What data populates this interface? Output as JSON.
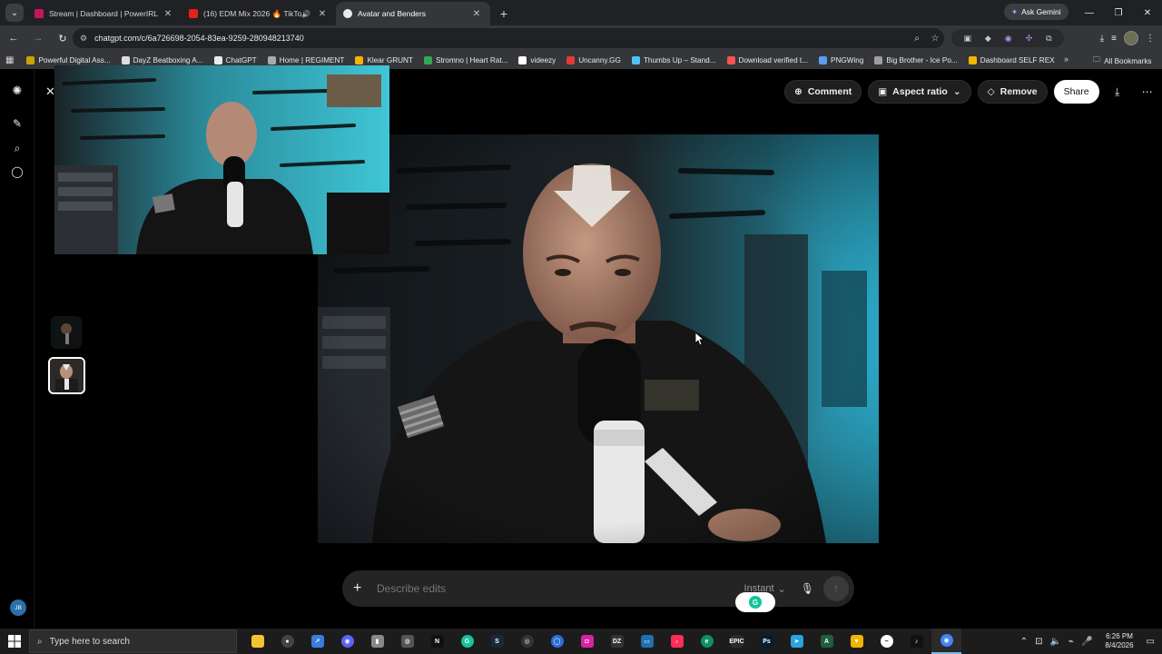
{
  "browser": {
    "tabs": [
      {
        "label": "Stream | Dashboard | PowerIRL",
        "fav_color": "#c2185b",
        "active": false
      },
      {
        "label": "(16) EDM Mix 2026 🔥 TikTo",
        "fav_color": "#e62117",
        "active": false,
        "audio": true
      },
      {
        "label": "Avatar and Benders",
        "fav_color": "#e8eaed",
        "active": true
      }
    ],
    "ask_gemini": "Ask Gemini",
    "url": "chatgpt.com/c/6a726698-2054-83ea-9259-280948213740",
    "bookmarks": [
      {
        "label": "Powerful Digital Ass...",
        "color": "#c7a400"
      },
      {
        "label": "DayZ Beatboxing A...",
        "color": "#dddddd"
      },
      {
        "label": "ChatGPT",
        "color": "#e8eaed"
      },
      {
        "label": "Home | REGIMENT",
        "color": "#aaaaaa"
      },
      {
        "label": "Klear GRUNT",
        "color": "#f4b400"
      },
      {
        "label": "Stromno | Heart Rat...",
        "color": "#34a853"
      },
      {
        "label": "videezy",
        "color": "#ffffff"
      },
      {
        "label": "Uncanny.GG",
        "color": "#e53935"
      },
      {
        "label": "Thumbs Up – Stand...",
        "color": "#4fc3f7"
      },
      {
        "label": "Download verified t...",
        "color": "#ff5252"
      },
      {
        "label": "PNGWing",
        "color": "#5c9cf5"
      },
      {
        "label": "Big Brother - Ice Po...",
        "color": "#9e9e9e"
      },
      {
        "label": "Dashboard SELF REX",
        "color": "#f5b400"
      }
    ],
    "all_bookmarks": "All Bookmarks"
  },
  "chat": {
    "actions": {
      "comment": "Comment",
      "aspect_ratio": "Aspect ratio",
      "remove": "Remove",
      "share": "Share"
    },
    "composer": {
      "placeholder": "Describe edits",
      "mode": "Instant"
    },
    "user_initials": "JB"
  },
  "taskbar": {
    "search_placeholder": "Type here to search",
    "time": "6:26 PM",
    "date": "8/4/2026",
    "apps": [
      {
        "name": "file-explorer",
        "color": "#f4c430",
        "glyph": ""
      },
      {
        "name": "obs",
        "color": "#444444",
        "glyph": "●"
      },
      {
        "name": "app-blue",
        "color": "#3b7ddd",
        "glyph": "↗"
      },
      {
        "name": "discord",
        "color": "#5865f2",
        "glyph": "◉"
      },
      {
        "name": "usb-app",
        "color": "#888888",
        "glyph": "▮"
      },
      {
        "name": "app-circle",
        "color": "#555555",
        "glyph": "◍"
      },
      {
        "name": "netflix",
        "color": "#111111",
        "glyph": "N"
      },
      {
        "name": "grammarly",
        "color": "#15c39a",
        "glyph": "G"
      },
      {
        "name": "steam",
        "color": "#1b2838",
        "glyph": "S"
      },
      {
        "name": "app-disc",
        "color": "#333333",
        "glyph": "◎"
      },
      {
        "name": "app-ring",
        "color": "#2a6fdb",
        "glyph": "◯"
      },
      {
        "name": "instagram",
        "color": "#d6249f",
        "glyph": "◘"
      },
      {
        "name": "dzl",
        "color": "#333333",
        "glyph": "DZ"
      },
      {
        "name": "app-window",
        "color": "#1f6fb2",
        "glyph": "▭"
      },
      {
        "name": "capcut",
        "color": "#ff2d55",
        "glyph": "♪"
      },
      {
        "name": "edge",
        "color": "#0b8f6a",
        "glyph": "e"
      },
      {
        "name": "epic",
        "color": "#2b2b2b",
        "glyph": "EPIC"
      },
      {
        "name": "photoshop",
        "color": "#001e36",
        "glyph": "Ps"
      },
      {
        "name": "telegram",
        "color": "#2aa3df",
        "glyph": "➤"
      },
      {
        "name": "app-a",
        "color": "#1f5f3f",
        "glyph": "A"
      },
      {
        "name": "app-v",
        "color": "#f2b400",
        "glyph": "▼"
      },
      {
        "name": "app-minus",
        "color": "#ffffff",
        "glyph": "−"
      },
      {
        "name": "tiktok",
        "color": "#111111",
        "glyph": "♪"
      },
      {
        "name": "chrome",
        "color": "#4285f4",
        "glyph": "◉",
        "active": true
      }
    ]
  }
}
